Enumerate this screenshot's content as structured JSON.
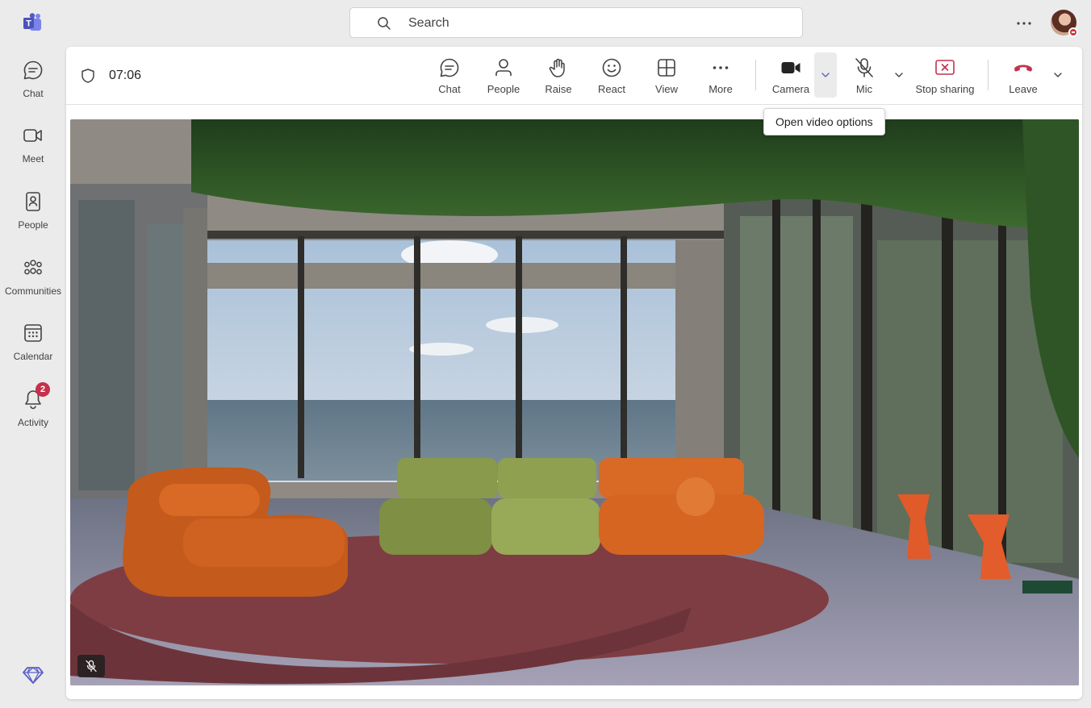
{
  "rail": {
    "items": [
      {
        "label": "Chat",
        "icon": "chat-icon"
      },
      {
        "label": "Meet",
        "icon": "video-camera-icon"
      },
      {
        "label": "People",
        "icon": "contact-card-icon"
      },
      {
        "label": "Communities",
        "icon": "communities-icon"
      },
      {
        "label": "Calendar",
        "icon": "calendar-icon"
      },
      {
        "label": "Activity",
        "icon": "bell-icon",
        "badge": "2"
      }
    ]
  },
  "search": {
    "placeholder": "Search"
  },
  "meeting": {
    "timer": "07:06",
    "toolbar": {
      "chat": "Chat",
      "people": "People",
      "raise": "Raise",
      "react": "React",
      "view": "View",
      "more": "More",
      "camera": "Camera",
      "mic": "Mic",
      "stop_sharing": "Stop sharing",
      "leave": "Leave"
    },
    "tooltip": "Open video options"
  },
  "colors": {
    "brand": "#5b5fc7",
    "leave_red": "#c4314b",
    "badge": "#c4314b",
    "stop_sharing_red": "#c4314b"
  }
}
